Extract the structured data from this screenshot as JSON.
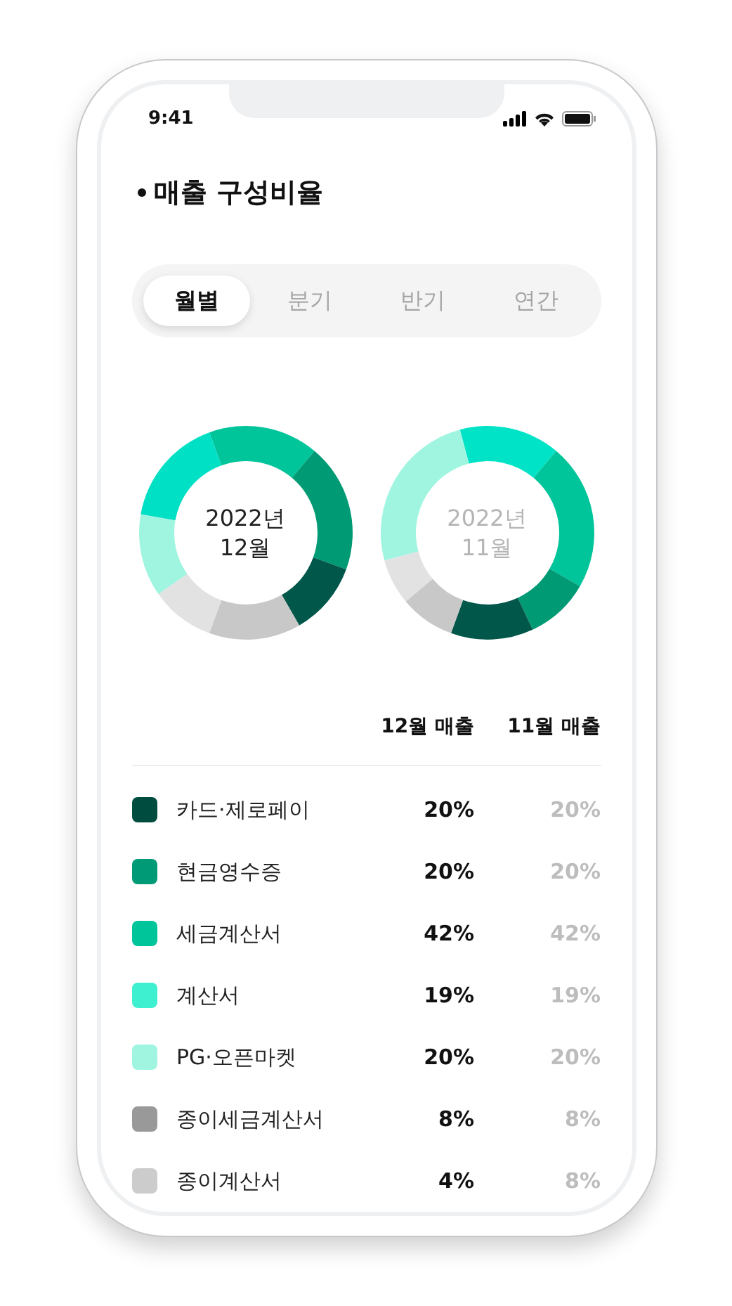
{
  "status_bar": {
    "time": "9:41"
  },
  "title": "매출 구성비율",
  "tabs": [
    {
      "label": "월별",
      "selected": true
    },
    {
      "label": "분기",
      "selected": false
    },
    {
      "label": "반기",
      "selected": false
    },
    {
      "label": "연간",
      "selected": false
    }
  ],
  "donuts": [
    {
      "year": "2022년",
      "month": "12월",
      "muted": false
    },
    {
      "year": "2022년",
      "month": "11월",
      "muted": true
    }
  ],
  "table": {
    "columns": [
      "12월 매출",
      "11월 매출"
    ],
    "rows": [
      {
        "name": "카드·제로페이",
        "color": "#004d3f",
        "current": "20%",
        "previous": "20%"
      },
      {
        "name": "현금영수증",
        "color": "#009a76",
        "current": "20%",
        "previous": "20%"
      },
      {
        "name": "세금계산서",
        "color": "#00c49a",
        "current": "42%",
        "previous": "42%"
      },
      {
        "name": "계산서",
        "color": "#3ff0d0",
        "current": "19%",
        "previous": "19%"
      },
      {
        "name": "PG·오픈마켓",
        "color": "#a0f5e0",
        "current": "20%",
        "previous": "20%"
      },
      {
        "name": "종이세금계산서",
        "color": "#999999",
        "current": "8%",
        "previous": "8%"
      },
      {
        "name": "종이계산서",
        "color": "#cccccc",
        "current": "4%",
        "previous": "8%"
      }
    ]
  }
}
